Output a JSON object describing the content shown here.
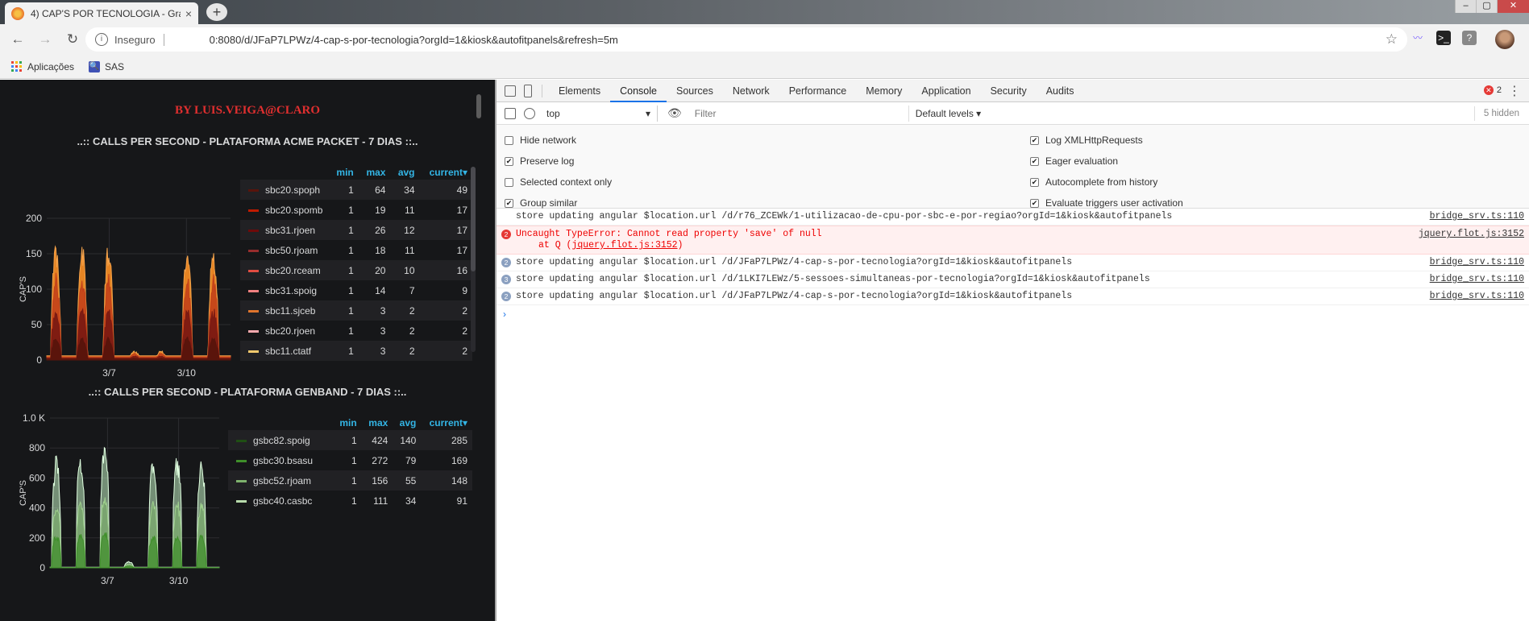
{
  "browser": {
    "tab_title": "4) CAP'S POR TECNOLOGIA - Gra",
    "tab_close": "×",
    "new_tab": "+",
    "security_label": "Inseguro",
    "url": "0:8080/d/JFaP7LPWz/4-cap-s-por-tecnologia?orgId=1&kiosk&autofitpanels&refresh=5m",
    "bookmarks": [
      {
        "label": "Aplicações",
        "icon": "apps-grid-icon"
      },
      {
        "label": "SAS",
        "icon": "sas-icon"
      }
    ],
    "window_controls": [
      "–",
      "▢",
      "✕"
    ]
  },
  "dashboard": {
    "byline": "BY LUIS.VEIGA@CLARO",
    "legend_headers": [
      "min",
      "max",
      "avg",
      "current▾"
    ],
    "panels": [
      {
        "title": "..:: CALLS PER SECOND - PLATAFORMA ACME PACKET - 7 DIAS ::..",
        "ylabel": "CAP'S",
        "yticks": [
          "200",
          "150",
          "100",
          "50",
          "0"
        ],
        "xticks": [
          "3/7",
          "3/10"
        ],
        "colors": {
          "orange": "#f08a24",
          "darkred": "#7b1a12"
        },
        "legend": [
          {
            "name": "sbc20.spoph",
            "color": "#58140c",
            "min": "1",
            "max": "64",
            "avg": "34",
            "current": "49"
          },
          {
            "name": "sbc20.spomb",
            "color": "#bf1b00",
            "min": "1",
            "max": "19",
            "avg": "11",
            "current": "17"
          },
          {
            "name": "sbc31.rjoen",
            "color": "#6e0a0a",
            "min": "1",
            "max": "26",
            "avg": "12",
            "current": "17"
          },
          {
            "name": "sbc50.rjoam",
            "color": "#962d2d",
            "min": "1",
            "max": "18",
            "avg": "11",
            "current": "17"
          },
          {
            "name": "sbc20.rceam",
            "color": "#e24d42",
            "min": "1",
            "max": "20",
            "avg": "10",
            "current": "16"
          },
          {
            "name": "sbc31.spoig",
            "color": "#f08080",
            "min": "1",
            "max": "14",
            "avg": "7",
            "current": "9"
          },
          {
            "name": "sbc11.sjceb",
            "color": "#e0752d",
            "min": "1",
            "max": "3",
            "avg": "2",
            "current": "2"
          },
          {
            "name": "sbc20.rjoen",
            "color": "#f9a9ae",
            "min": "1",
            "max": "3",
            "avg": "2",
            "current": "2"
          },
          {
            "name": "sbc11.ctatf",
            "color": "#f2c96d",
            "min": "1",
            "max": "3",
            "avg": "2",
            "current": "2"
          }
        ]
      },
      {
        "title": "..:: CALLS PER SECOND - PLATAFORMA GENBAND - 7 DIAS ::..",
        "ylabel": "CAP'S",
        "yticks": [
          "1.0 K",
          "800",
          "600",
          "400",
          "200",
          "0"
        ],
        "xticks": [
          "3/7",
          "3/10"
        ],
        "colors": {
          "light": "#c3f0c3",
          "mid": "#7eb26d"
        },
        "legend": [
          {
            "name": "gsbc82.spoig",
            "color": "#1f4e14",
            "min": "1",
            "max": "424",
            "avg": "140",
            "current": "285"
          },
          {
            "name": "gsbc30.bsasu",
            "color": "#3f8f2a",
            "min": "1",
            "max": "272",
            "avg": "79",
            "current": "169"
          },
          {
            "name": "gsbc52.rjoam",
            "color": "#7eb26d",
            "min": "1",
            "max": "156",
            "avg": "55",
            "current": "148"
          },
          {
            "name": "gsbc40.casbc",
            "color": "#b7dbab",
            "min": "1",
            "max": "111",
            "avg": "34",
            "current": "91"
          }
        ]
      }
    ]
  },
  "devtools": {
    "tabs": [
      "Elements",
      "Console",
      "Sources",
      "Network",
      "Performance",
      "Memory",
      "Application",
      "Security",
      "Audits"
    ],
    "active_tab": "Console",
    "error_count": "2",
    "menu": "⋮",
    "context": "top",
    "filter_placeholder": "Filter",
    "levels": "Default levels ▾",
    "hidden": "5 hidden",
    "settings_left": [
      {
        "label": "Hide network",
        "checked": false
      },
      {
        "label": "Preserve log",
        "checked": true
      },
      {
        "label": "Selected context only",
        "checked": false
      },
      {
        "label": "Group similar",
        "checked": true
      }
    ],
    "settings_right": [
      {
        "label": "Log XMLHttpRequests",
        "checked": true
      },
      {
        "label": "Eager evaluation",
        "checked": true
      },
      {
        "label": "Autocomplete from history",
        "checked": true
      },
      {
        "label": "Evaluate triggers user activation",
        "checked": true
      }
    ],
    "messages": [
      {
        "type": "log",
        "count": "",
        "text": "store updating angular $location.url /d/r76_ZCEWk/1-utilizacao-de-cpu-por-sbc-e-por-regiao?orgId=1&kiosk&autofitpanels",
        "source": "bridge_srv.ts:110"
      },
      {
        "type": "error",
        "count": "2",
        "text": "Uncaught TypeError: Cannot read property 'save' of null",
        "sub_prefix": "at Q (",
        "sub_link": "jquery.flot.js:3152",
        "sub_suffix": ")",
        "source": "jquery.flot.js:3152"
      },
      {
        "type": "log",
        "count": "2",
        "text": "store updating angular $location.url /d/JFaP7LPWz/4-cap-s-por-tecnologia?orgId=1&kiosk&autofitpanels",
        "source": "bridge_srv.ts:110"
      },
      {
        "type": "log",
        "count": "3",
        "text": "store updating angular $location.url /d/1LKI7LEWz/5-sessoes-simultaneas-por-tecnologia?orgId=1&kiosk&autofitpanels",
        "source": "bridge_srv.ts:110"
      },
      {
        "type": "log",
        "count": "2",
        "text": "store updating angular $location.url /d/JFaP7LPWz/4-cap-s-por-tecnologia?orgId=1&kiosk&autofitpanels",
        "source": "bridge_srv.ts:110"
      }
    ],
    "prompt": "›"
  }
}
